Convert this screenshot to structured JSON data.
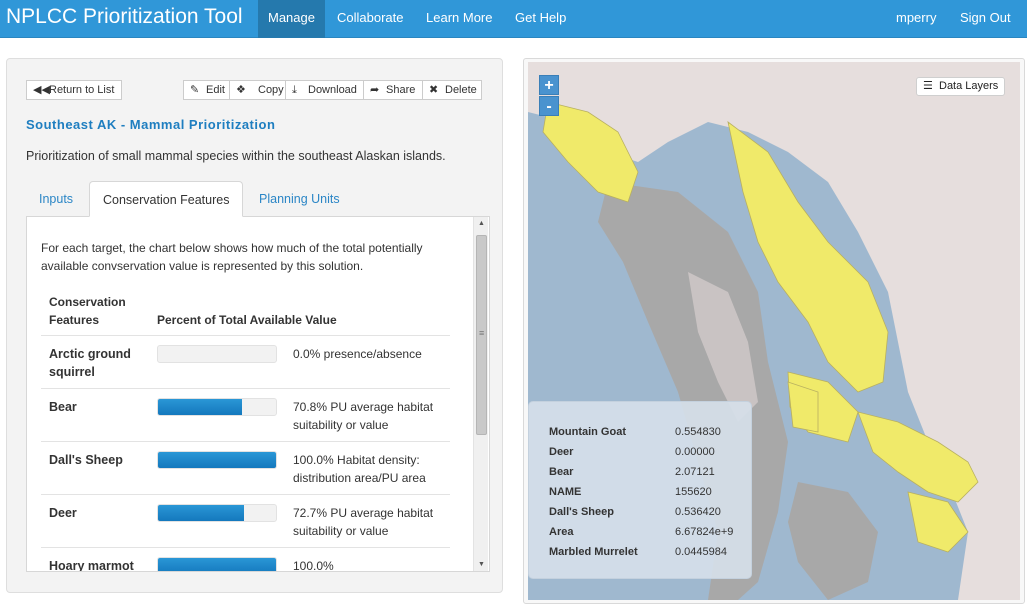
{
  "header": {
    "brand": "NPLCC Prioritization Tool",
    "nav": [
      "Manage",
      "Collaborate",
      "Learn More",
      "Get Help"
    ],
    "user": "mperry",
    "sign_out": "Sign Out"
  },
  "toolbar": {
    "return_label": "Return to List",
    "edit_label": "Edit",
    "copy_label": "Copy",
    "download_label": "Download",
    "share_label": "Share",
    "delete_label": "Delete"
  },
  "scenario": {
    "title": "Southeast AK - Mammal Prioritization",
    "description": "Prioritization of small mammal species within the southeast Alaskan islands."
  },
  "tabs": [
    "Inputs",
    "Conservation Features",
    "Planning Units"
  ],
  "features": {
    "intro": "For each target, the chart below shows how much of the total potentially available convservation value is represented by this solution.",
    "col_feature": "Conservation Features",
    "col_value": "Percent of Total Available Value",
    "rows": [
      {
        "name": "Arctic ground squirrel",
        "percent": 0.0,
        "label": "0.0% presence/absence"
      },
      {
        "name": "Bear",
        "percent": 70.8,
        "label": "70.8% PU average habitat suitability or value"
      },
      {
        "name": "Dall's Sheep",
        "percent": 100.0,
        "label": "100.0% Habitat density: distribution area/PU area"
      },
      {
        "name": "Deer",
        "percent": 72.7,
        "label": "72.7% PU average habitat suitability or value"
      },
      {
        "name": "Hoary marmot",
        "percent": 100.0,
        "label": "100.0%"
      }
    ]
  },
  "map": {
    "zoom_in": "+",
    "zoom_out": "-",
    "layers_label": "Data Layers",
    "attributes": [
      {
        "key": "Mountain Goat",
        "value": "0.554830"
      },
      {
        "key": "Deer",
        "value": "0.00000"
      },
      {
        "key": "Bear",
        "value": "2.07121"
      },
      {
        "key": "NAME",
        "value": "155620"
      },
      {
        "key": "Dall's Sheep",
        "value": "0.536420"
      },
      {
        "key": "Area",
        "value": "6.67824e+9"
      },
      {
        "key": "Marbled Murrelet",
        "value": "0.0445984"
      }
    ]
  },
  "colors": {
    "navbar": "#3097d8",
    "nav_active": "#2579ad",
    "title": "#1e7ec0",
    "bar": "#1a86c8",
    "selected_unit": "#f0ea6a",
    "land": "#e6dedd",
    "water": "#9fb8cf"
  }
}
